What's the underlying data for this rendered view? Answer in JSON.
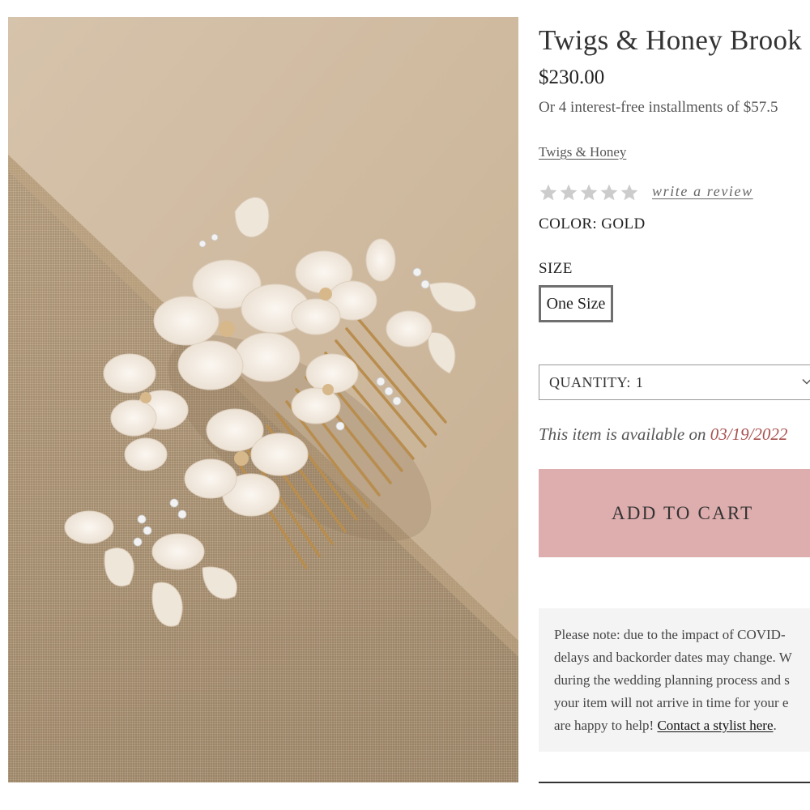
{
  "product": {
    "image_alt": "Twigs & Honey flower hair comb",
    "title": "Twigs & Honey Brook",
    "price": "$230.00",
    "installments": "Or 4 interest-free installments of $57.5",
    "brand": "Twigs & Honey",
    "rating": {
      "stars_filled": 0,
      "stars_total": 5,
      "review_link": "write a review"
    },
    "color_label": "COLOR:",
    "color_value": "GOLD",
    "size_label": "SIZE",
    "size_options": [
      "One Size"
    ],
    "quantity": {
      "label": "QUANTITY:",
      "value": "1"
    },
    "availability": {
      "text": "This item is available on ",
      "date": "03/19/2022"
    },
    "add_to_cart": "ADD TO CART",
    "notice": {
      "lines": [
        "Please note: due to the impact of COVID-",
        "delays and backorder dates may change. W",
        "during the wedding planning process and s",
        "your item will not arrive in time for your e",
        "are happy to help! "
      ],
      "link": "Contact a stylist here",
      "end": "."
    }
  },
  "colors": {
    "cart_button": "#deadad",
    "availability_date": "#a8504e",
    "star_empty": "#cccccc",
    "notice_bg": "#f4f4f4"
  },
  "icons": {
    "rating": "star-icon",
    "dropdown": "chevron-down-icon"
  }
}
